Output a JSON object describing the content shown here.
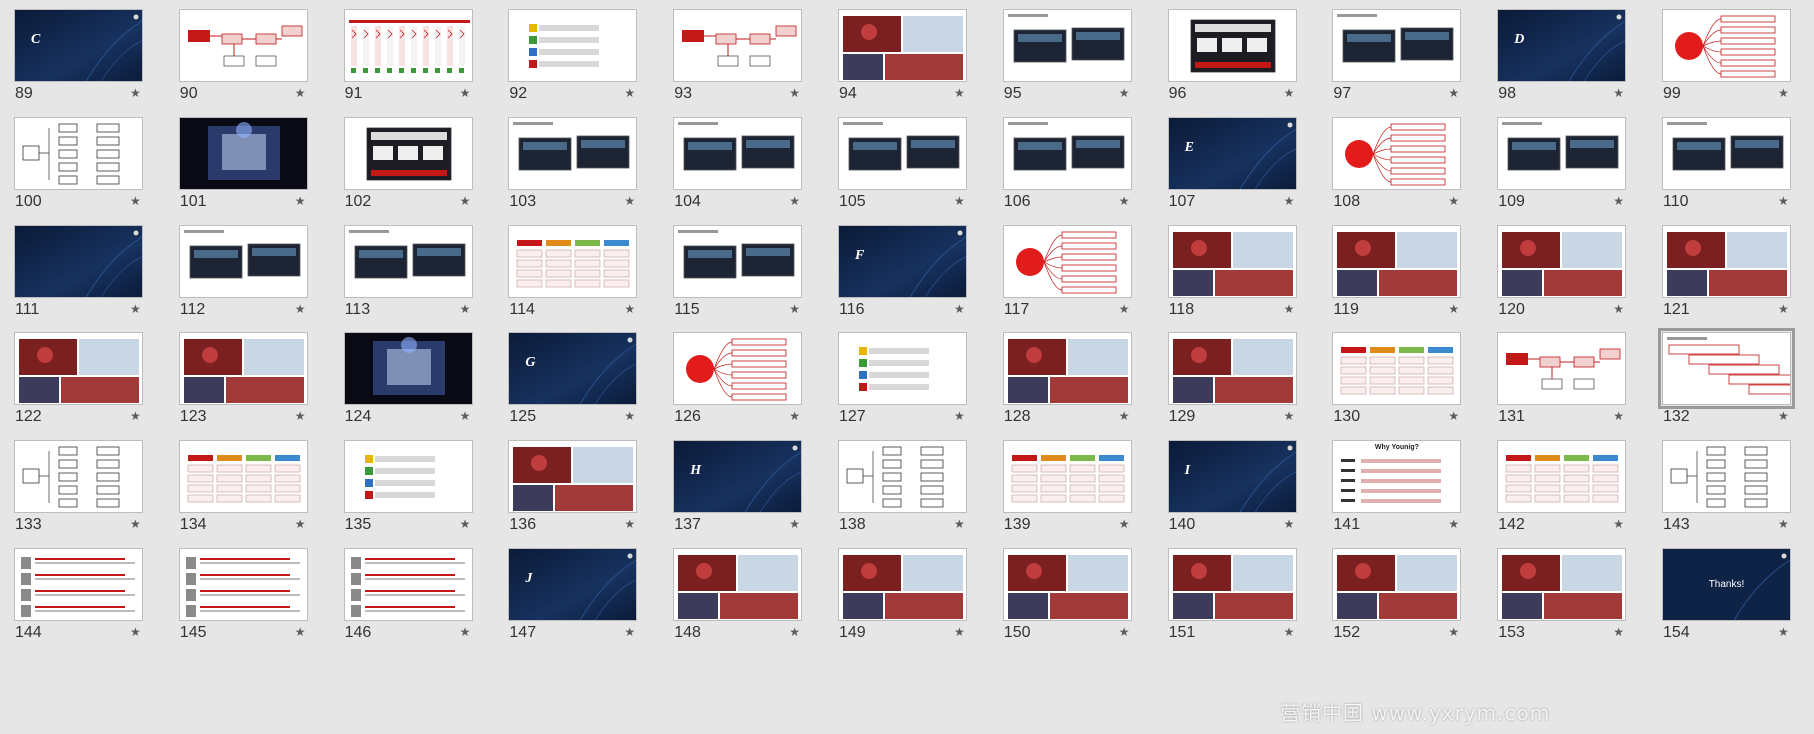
{
  "slide_sorter": {
    "star_glyph": "★",
    "selected_slide": 132,
    "colors": {
      "background": "#e6e6e6",
      "navy": "#0f2347",
      "accent_red": "#c21818",
      "selection_border": "#9a9a9a"
    },
    "slides": [
      {
        "number": "89",
        "kind": "section",
        "letter": "C"
      },
      {
        "number": "90",
        "kind": "flowchart"
      },
      {
        "number": "91",
        "kind": "timeline"
      },
      {
        "number": "92",
        "kind": "steps"
      },
      {
        "number": "93",
        "kind": "flowchart"
      },
      {
        "number": "94",
        "kind": "photos"
      },
      {
        "number": "95",
        "kind": "screens"
      },
      {
        "number": "96",
        "kind": "bigscreen"
      },
      {
        "number": "97",
        "kind": "screens"
      },
      {
        "number": "98",
        "kind": "section",
        "letter": "D"
      },
      {
        "number": "99",
        "kind": "mindmap"
      },
      {
        "number": "100",
        "kind": "tree"
      },
      {
        "number": "101",
        "kind": "dark"
      },
      {
        "number": "102",
        "kind": "bigscreen"
      },
      {
        "number": "103",
        "kind": "screens"
      },
      {
        "number": "104",
        "kind": "screens"
      },
      {
        "number": "105",
        "kind": "screens"
      },
      {
        "number": "106",
        "kind": "screens"
      },
      {
        "number": "107",
        "kind": "section",
        "letter": "E"
      },
      {
        "number": "108",
        "kind": "mindmap"
      },
      {
        "number": "109",
        "kind": "screens"
      },
      {
        "number": "110",
        "kind": "screens"
      },
      {
        "number": "111",
        "kind": "section",
        "letter": ""
      },
      {
        "number": "112",
        "kind": "screens"
      },
      {
        "number": "113",
        "kind": "screens"
      },
      {
        "number": "114",
        "kind": "table"
      },
      {
        "number": "115",
        "kind": "screens"
      },
      {
        "number": "116",
        "kind": "section",
        "letter": "F"
      },
      {
        "number": "117",
        "kind": "mindmap"
      },
      {
        "number": "118",
        "kind": "photos"
      },
      {
        "number": "119",
        "kind": "photos"
      },
      {
        "number": "120",
        "kind": "photos"
      },
      {
        "number": "121",
        "kind": "photos"
      },
      {
        "number": "122",
        "kind": "photos"
      },
      {
        "number": "123",
        "kind": "photos"
      },
      {
        "number": "124",
        "kind": "dark"
      },
      {
        "number": "125",
        "kind": "section",
        "letter": "G"
      },
      {
        "number": "126",
        "kind": "mindmap"
      },
      {
        "number": "127",
        "kind": "steps"
      },
      {
        "number": "128",
        "kind": "photos"
      },
      {
        "number": "129",
        "kind": "photos"
      },
      {
        "number": "130",
        "kind": "table"
      },
      {
        "number": "131",
        "kind": "flowchart"
      },
      {
        "number": "132",
        "kind": "stairs"
      },
      {
        "number": "133",
        "kind": "tree"
      },
      {
        "number": "134",
        "kind": "table"
      },
      {
        "number": "135",
        "kind": "steps"
      },
      {
        "number": "136",
        "kind": "photos"
      },
      {
        "number": "137",
        "kind": "section",
        "letter": "H"
      },
      {
        "number": "138",
        "kind": "tree"
      },
      {
        "number": "139",
        "kind": "table"
      },
      {
        "number": "140",
        "kind": "section",
        "letter": "I"
      },
      {
        "number": "141",
        "kind": "whyyou",
        "heading": "Why Younig?"
      },
      {
        "number": "142",
        "kind": "table"
      },
      {
        "number": "143",
        "kind": "tree"
      },
      {
        "number": "144",
        "kind": "people"
      },
      {
        "number": "145",
        "kind": "people"
      },
      {
        "number": "146",
        "kind": "people"
      },
      {
        "number": "147",
        "kind": "section",
        "letter": "J"
      },
      {
        "number": "148",
        "kind": "photos"
      },
      {
        "number": "149",
        "kind": "photos"
      },
      {
        "number": "150",
        "kind": "photos"
      },
      {
        "number": "151",
        "kind": "photos"
      },
      {
        "number": "152",
        "kind": "photos"
      },
      {
        "number": "153",
        "kind": "photos"
      },
      {
        "number": "154",
        "kind": "thanks",
        "text": "Thanks!"
      }
    ]
  },
  "watermark": "营销中国 www.yxrym.com"
}
